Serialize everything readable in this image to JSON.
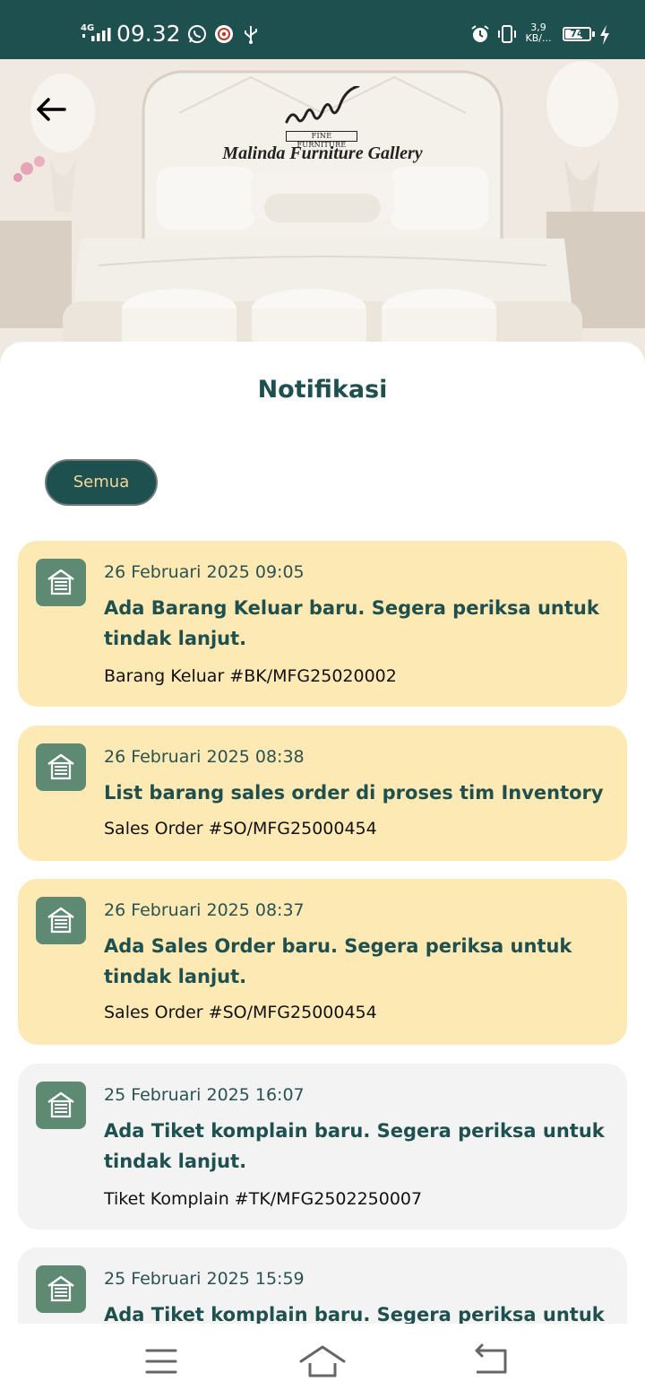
{
  "status_bar": {
    "network": "4G",
    "time": "09.32",
    "speed_value": "3,9",
    "speed_unit": "KB/...",
    "battery_percent": 74,
    "battery_text": "74"
  },
  "header": {
    "back_icon": "arrow-left-icon",
    "brand_sub": "FINE FURNITURE",
    "brand_name": "Malinda Furniture Gallery"
  },
  "page": {
    "title": "Notifikasi",
    "filter_label": "Semua"
  },
  "notifications": [
    {
      "date": "26 Februari 2025 09:05",
      "title": "Ada Barang Keluar baru. Segera periksa untuk tindak lanjut.",
      "reference": "Barang Keluar #BK/MFG25020002",
      "status": "unread",
      "icon": "warehouse-icon"
    },
    {
      "date": "26 Februari 2025 08:38",
      "title": "List barang sales order di proses tim Inventory",
      "reference": "Sales Order #SO/MFG25000454",
      "status": "unread",
      "icon": "warehouse-icon"
    },
    {
      "date": "26 Februari 2025 08:37",
      "title": "Ada Sales Order baru. Segera periksa untuk tindak lanjut.",
      "reference": "Sales Order #SO/MFG25000454",
      "status": "unread",
      "icon": "warehouse-icon"
    },
    {
      "date": "25 Februari 2025 16:07",
      "title": "Ada Tiket komplain baru. Segera periksa untuk tindak lanjut.",
      "reference": "Tiket Komplain #TK/MFG2502250007",
      "status": "read",
      "icon": "warehouse-icon"
    },
    {
      "date": "25 Februari 2025 15:59",
      "title": "Ada Tiket komplain baru. Segera periksa untuk",
      "status": "read",
      "icon": "warehouse-icon"
    }
  ],
  "navigation": {
    "menu_icon": "menu-icon",
    "home_icon": "home-icon",
    "back_icon": "back-icon"
  },
  "colors": {
    "primary": "#1f5050",
    "unread_card": "#fde9b3",
    "read_card": "#f3f3f3",
    "icon_badge": "#5e8a73",
    "chip_text": "#f3d79a"
  }
}
